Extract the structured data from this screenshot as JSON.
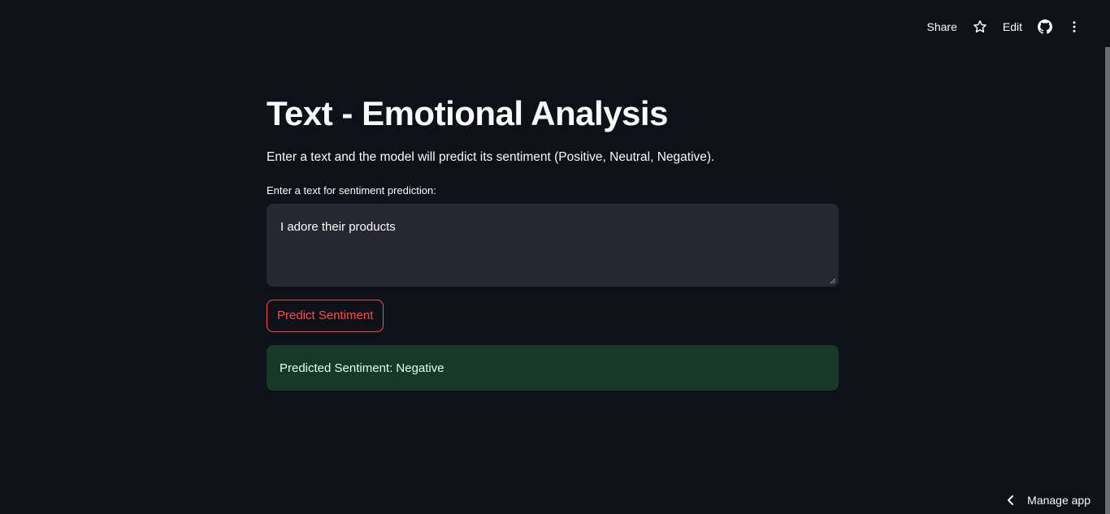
{
  "toolbar": {
    "share_label": "Share",
    "star_icon": "star-icon",
    "edit_label": "Edit",
    "github_icon": "github-icon",
    "menu_icon": "vertical-dots-icon"
  },
  "main": {
    "title": "Text - Emotional Analysis",
    "description": "Enter a text and the model will predict its sentiment (Positive, Neutral, Negative).",
    "input_label": "Enter a text for sentiment prediction:",
    "input_value": "I adore their products",
    "predict_button": "Predict Sentiment",
    "result_text": "Predicted Sentiment: Negative"
  },
  "footer": {
    "manage_label": "Manage app",
    "chevron_icon": "chevron-left-icon"
  },
  "colors": {
    "background": "#0e1117",
    "accent": "#ff4b4b",
    "success_bg": "#173928",
    "input_bg": "#262730"
  }
}
